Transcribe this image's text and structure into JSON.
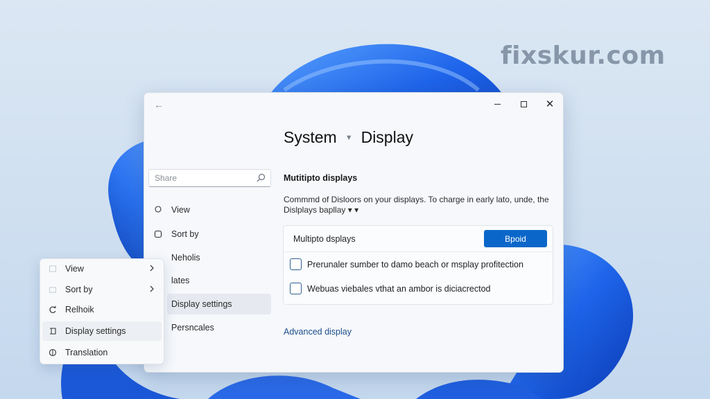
{
  "watermark": "fixskur.com",
  "window": {
    "breadcrumb": {
      "parent": "System",
      "current": "Display"
    },
    "search": {
      "placeholder": "Share"
    },
    "nav": [
      {
        "label": "View",
        "icon": "pin-icon"
      },
      {
        "label": "Sort by",
        "icon": "square-icon"
      },
      {
        "label": "Neholis",
        "icon": ""
      },
      {
        "label": "lates",
        "icon": ""
      },
      {
        "label": "Display settings",
        "icon": "",
        "selected": true
      },
      {
        "label": "Persncales",
        "icon": ""
      }
    ],
    "section": {
      "title": "Mutitipto displays",
      "description": "Commmd of Disloors on your displays. To charge in early lato, unde, the Dislplays bapllay ▾ ▾"
    },
    "card": {
      "header_label": "Multipto dsplays",
      "button_label": "Bpoid",
      "options": [
        {
          "label": "Prerunaler sumber to damo beach or msplay profitection",
          "checked": false
        },
        {
          "label": "Webuas viebales vthat an ambor is diciacrectod",
          "checked": false
        }
      ]
    },
    "advanced_link": "Advanced display"
  },
  "context_menu": {
    "items": [
      {
        "label": "View",
        "icon": "view-icon",
        "submenu": true
      },
      {
        "label": "Sort by",
        "icon": "sort-icon",
        "submenu": true
      },
      {
        "label": "Relhoik",
        "icon": "refresh-icon",
        "submenu": false
      },
      {
        "label": "Display settings",
        "icon": "display-icon",
        "submenu": false
      },
      {
        "label": "Translation",
        "icon": "personalize-icon",
        "submenu": false
      }
    ]
  },
  "colors": {
    "accent": "#0a67c9",
    "link": "#1c4e8c",
    "wallpaper_blue": "#1b5ee0"
  }
}
